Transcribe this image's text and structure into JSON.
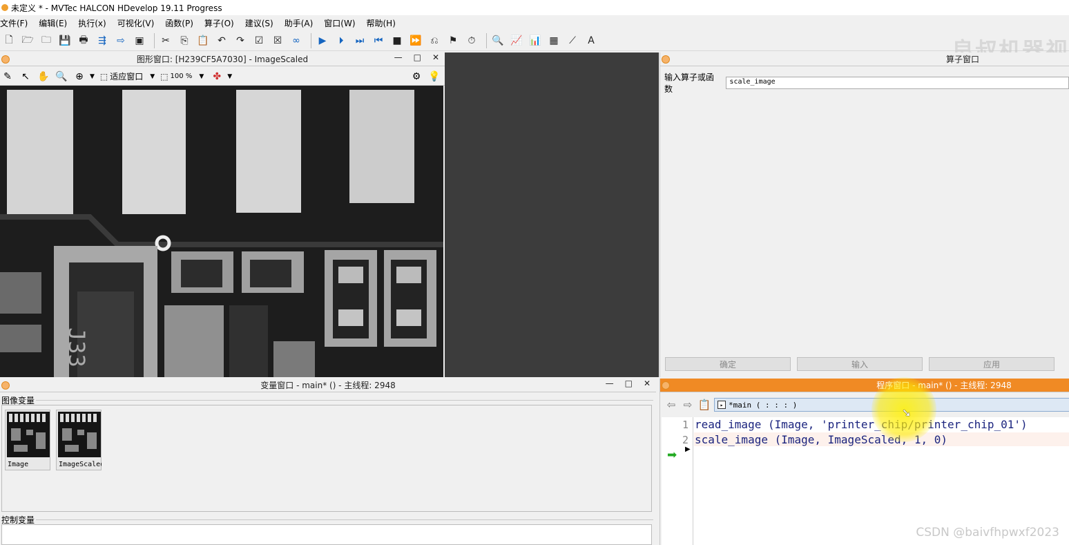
{
  "window_title": "未定义 * - MVTec HALCON HDevelop 19.11 Progress",
  "menu": [
    "文件(F)",
    "编辑(E)",
    "执行(x)",
    "可视化(V)",
    "函数(P)",
    "算子(O)",
    "建议(S)",
    "助手(A)",
    "窗口(W)",
    "帮助(H)"
  ],
  "watermark": "良叔机器视",
  "graphics": {
    "title": "图形窗口: [H239CF5A7030] - ImageScaled",
    "fit_label": "适应窗口",
    "zoom_label": "100 %"
  },
  "operator": {
    "title": "算子窗口",
    "input_label": "输入算子或函数",
    "input_value": "scale_image",
    "buttons": [
      "确定",
      "输入",
      "应用"
    ]
  },
  "variables": {
    "title": "变量窗口 - main* () - 主线程: 2948",
    "iconic_label": "图像变量",
    "control_label": "控制变量",
    "thumbs": [
      "Image",
      "ImageScaled"
    ]
  },
  "program": {
    "title": "程序窗口 - main* () - 主线程: 2948",
    "procedure": "*main ( : : : )",
    "lines": [
      {
        "no": "1",
        "code": "read_image (Image, 'printer_chip/printer_chip_01')"
      },
      {
        "no": "2",
        "code": "scale_image (Image, ImageScaled, 1, 0)"
      }
    ]
  },
  "footer_watermark": "CSDN @baivfhpwxf2023"
}
